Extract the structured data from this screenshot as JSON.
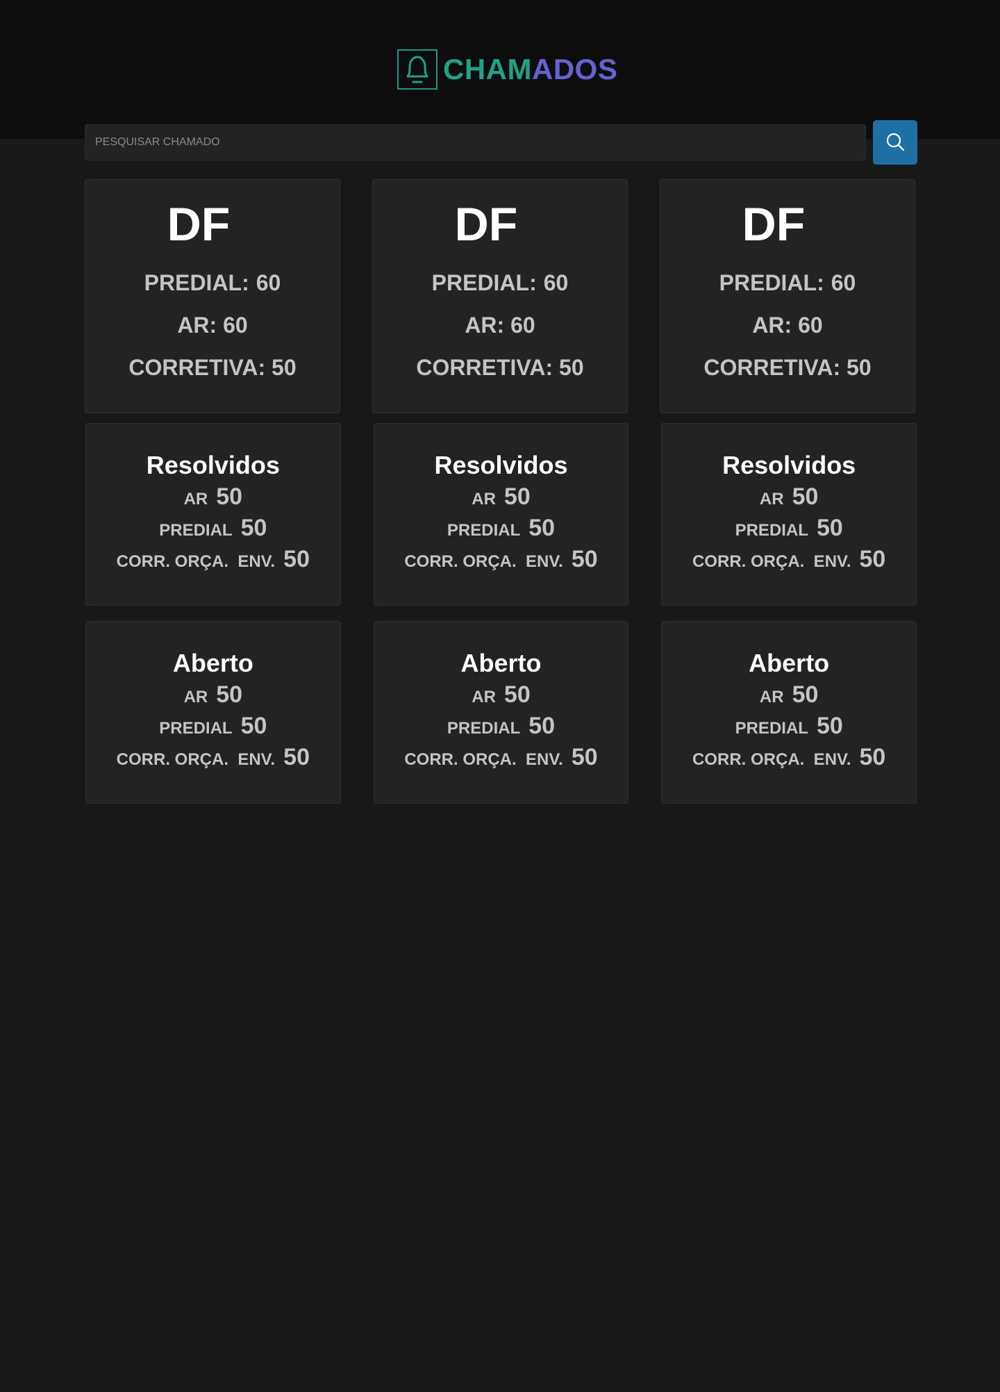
{
  "header": {
    "title_part1": "CHAM",
    "title_part2": "ADOS",
    "logo_icon": "bell-icon",
    "colors": {
      "title_part1": "#22a088",
      "title_part2": "#6663d0"
    }
  },
  "search": {
    "placeholder": "PESQUISAR CHAMADO",
    "value": "",
    "button_icon": "search-icon",
    "button_color": "#1e6fa3"
  },
  "region_cards": [
    {
      "title": "DF",
      "predial_label": "PREDIAL:",
      "predial_value": "60",
      "ar_label": "AR:",
      "ar_value": "60",
      "corretiva_label": "CORRETIVA:",
      "corretiva_value": "50"
    },
    {
      "title": "DF",
      "predial_label": "PREDIAL:",
      "predial_value": "60",
      "ar_label": "AR:",
      "ar_value": "60",
      "corretiva_label": "CORRETIVA:",
      "corretiva_value": "50"
    },
    {
      "title": "DF",
      "predial_label": "PREDIAL:",
      "predial_value": "60",
      "ar_label": "AR:",
      "ar_value": "60",
      "corretiva_label": "CORRETIVA:",
      "corretiva_value": "50"
    }
  ],
  "resolved_cards": [
    {
      "title": "Resolvidos",
      "ar_label": "AR",
      "ar_value": "50",
      "predial_label": "PREDIAL",
      "predial_value": "50",
      "corr_label": "CORR. ORÇA.  ENV.",
      "corr_value": "50"
    },
    {
      "title": "Resolvidos",
      "ar_label": "AR",
      "ar_value": "50",
      "predial_label": "PREDIAL",
      "predial_value": "50",
      "corr_label": "CORR. ORÇA.  ENV.",
      "corr_value": "50"
    },
    {
      "title": "Resolvidos",
      "ar_label": "AR",
      "ar_value": "50",
      "predial_label": "PREDIAL",
      "predial_value": "50",
      "corr_label": "CORR. ORÇA.  ENV.",
      "corr_value": "50"
    }
  ],
  "open_cards": [
    {
      "title": "Aberto",
      "ar_label": "AR",
      "ar_value": "50",
      "predial_label": "PREDIAL",
      "predial_value": "50",
      "corr_label": "CORR. ORÇA.  ENV.",
      "corr_value": "50"
    },
    {
      "title": "Aberto",
      "ar_label": "AR",
      "ar_value": "50",
      "predial_label": "PREDIAL",
      "predial_value": "50",
      "corr_label": "CORR. ORÇA.  ENV.",
      "corr_value": "50"
    },
    {
      "title": "Aberto",
      "ar_label": "AR",
      "ar_value": "50",
      "predial_label": "PREDIAL",
      "predial_value": "50",
      "corr_label": "CORR. ORÇA.  ENV.",
      "corr_value": "50"
    }
  ]
}
